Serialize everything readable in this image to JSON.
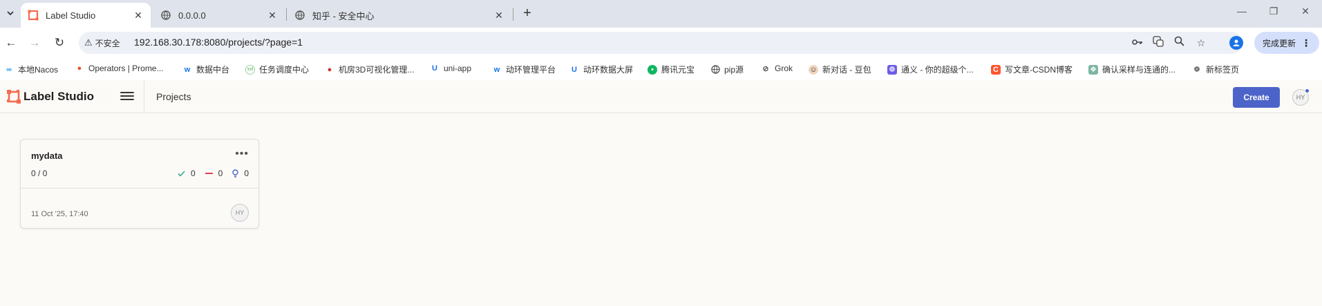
{
  "browser": {
    "tabs": [
      {
        "title": "Label Studio",
        "active": true
      },
      {
        "title": "0.0.0.0",
        "active": false
      },
      {
        "title": "知乎 - 安全中心",
        "active": false
      }
    ],
    "close_glyph": "✕",
    "new_tab_glyph": "+",
    "address": {
      "security_label": "不安全",
      "url": "192.168.30.178:8080/projects/?page=1"
    },
    "update_button": "完成更新",
    "bookmarks": [
      "本地Nacos",
      "Operators | Prome...",
      "数据中台",
      "任务调度中心",
      "机房3D可视化管理...",
      "uni-app",
      "动环管理平台",
      "动环数据大屏",
      "腾讯元宝",
      "pip源",
      "Grok",
      "新对话 - 豆包",
      "通义 - 你的超级个...",
      "写文章-CSDN博客",
      "确认采样与连通的...",
      "新标签页"
    ]
  },
  "app": {
    "brand": "Label Studio",
    "breadcrumb": "Projects",
    "create_button": "Create",
    "user_initials": "HY",
    "accent_color": "#4c64c9",
    "logo_color": "#f36c51"
  },
  "projects": [
    {
      "title": "mydata",
      "progress": "0 / 0",
      "completed": "0",
      "skipped": "0",
      "predictions": "0",
      "date": "11 Oct '25, 17:40",
      "owner_initials": "HY"
    }
  ]
}
